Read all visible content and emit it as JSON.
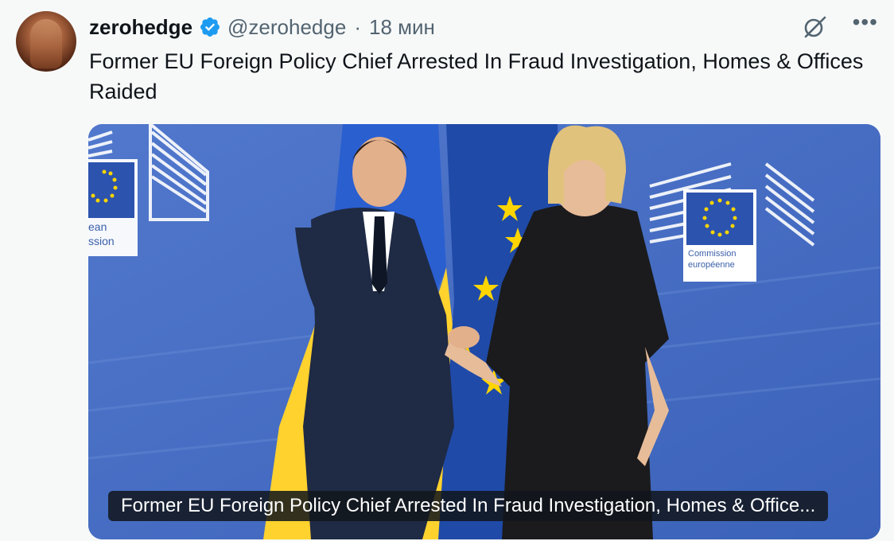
{
  "tweet": {
    "author_name": "zerohedge",
    "handle": "@zerohedge",
    "separator": "·",
    "time": "18 мин",
    "text": "Former EU Foreign Policy Chief Arrested In Fraud Investigation, Homes & Offices Raided",
    "link_card_title": "Former EU Foreign Policy Chief Arrested In Fraud Investigation, Homes & Office...",
    "icons": {
      "verified": "verified-badge-icon",
      "grok": "grok-icon",
      "more": "more-icon"
    },
    "colors": {
      "verified": "#1d9bf0",
      "muted": "#536471",
      "background": "#f7f9f9"
    }
  },
  "photo": {
    "backdrop_text_left": [
      "ean",
      "ssion"
    ],
    "backdrop_text_right": [
      "Commission",
      "européenne"
    ]
  }
}
